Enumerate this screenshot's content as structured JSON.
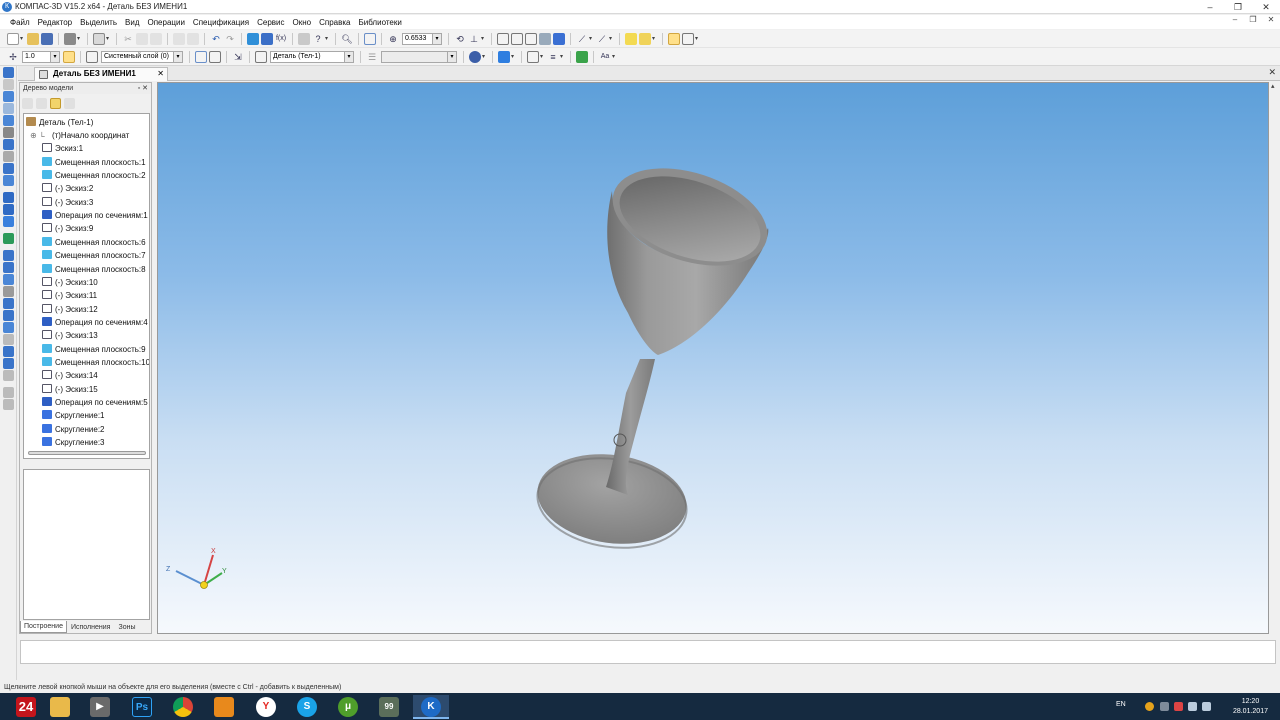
{
  "window": {
    "title": "КОМПАС-3D V15.2  x64 - Деталь БЕЗ ИМЕНИ1"
  },
  "menu": [
    "Файл",
    "Редактор",
    "Выделить",
    "Вид",
    "Операции",
    "Спецификация",
    "Сервис",
    "Окно",
    "Справка",
    "Библиотеки"
  ],
  "toolbar": {
    "zoom_value": "0.6533",
    "step_value": "1.0",
    "layer_value": "Системный слой (0)",
    "body_value": "Деталь (Тел-1)"
  },
  "document_tab": {
    "label": "Деталь БЕЗ ИМЕНИ1"
  },
  "model_tree": {
    "header": "Дерево модели",
    "root": "Деталь (Тел-1)",
    "items": [
      {
        "label": "(т)Начало координат",
        "icon": "origin-icon"
      },
      {
        "label": "Эскиз:1",
        "icon": "sketch-icon"
      },
      {
        "label": "Смещенная плоскость:1",
        "icon": "plane-icon"
      },
      {
        "label": "Смещенная плоскость:2",
        "icon": "plane-icon"
      },
      {
        "label": "(-) Эскиз:2",
        "icon": "sketch-icon"
      },
      {
        "label": "(-) Эскиз:3",
        "icon": "sketch-icon"
      },
      {
        "label": "Операция по сечениям:1",
        "icon": "loft-operation-icon"
      },
      {
        "label": "(-) Эскиз:9",
        "icon": "sketch-icon"
      },
      {
        "label": "Смещенная плоскость:6",
        "icon": "plane-icon"
      },
      {
        "label": "Смещенная плоскость:7",
        "icon": "plane-icon"
      },
      {
        "label": "Смещенная плоскость:8",
        "icon": "plane-icon"
      },
      {
        "label": "(-) Эскиз:10",
        "icon": "sketch-icon"
      },
      {
        "label": "(-) Эскиз:11",
        "icon": "sketch-icon"
      },
      {
        "label": "(-) Эскиз:12",
        "icon": "sketch-icon"
      },
      {
        "label": "Операция по сечениям:4",
        "icon": "loft-operation-icon"
      },
      {
        "label": "(-) Эскиз:13",
        "icon": "sketch-icon"
      },
      {
        "label": "Смещенная плоскость:9",
        "icon": "plane-icon"
      },
      {
        "label": "Смещенная плоскость:10",
        "icon": "plane-icon"
      },
      {
        "label": "(-) Эскиз:14",
        "icon": "sketch-icon"
      },
      {
        "label": "(-) Эскиз:15",
        "icon": "sketch-icon"
      },
      {
        "label": "Операция по сечениям:5",
        "icon": "loft-operation-icon"
      },
      {
        "label": "Скругление:1",
        "icon": "fillet-icon"
      },
      {
        "label": "Скругление:2",
        "icon": "fillet-icon"
      },
      {
        "label": "Скругление:3",
        "icon": "fillet-icon"
      }
    ],
    "tabs": [
      "Построение",
      "Исполнения",
      "Зоны"
    ]
  },
  "viewport": {
    "axes": {
      "x": "X",
      "y": "Y",
      "z": "Z"
    },
    "model": "wine-glass"
  },
  "status": {
    "hint": "Щелкните левой кнопкой мыши на объекте для его выделения (вместе с Ctrl - добавить к выделенным)"
  },
  "taskbar": {
    "apps": [
      "24",
      "file-explorer-icon",
      "media-player-icon",
      "Ps",
      "chrome-icon",
      "pdf-icon",
      "yandex-icon",
      "skype-icon",
      "utorrent-icon",
      "99",
      "kompas-icon"
    ],
    "lang": "EN",
    "time": "12:20",
    "date": "28.01.2017"
  },
  "colors": {
    "viewport_top": "#5d9fd9",
    "viewport_bottom": "#f6f9fd",
    "model_gray": "#8f8f8f",
    "taskbar": "#152a40"
  }
}
